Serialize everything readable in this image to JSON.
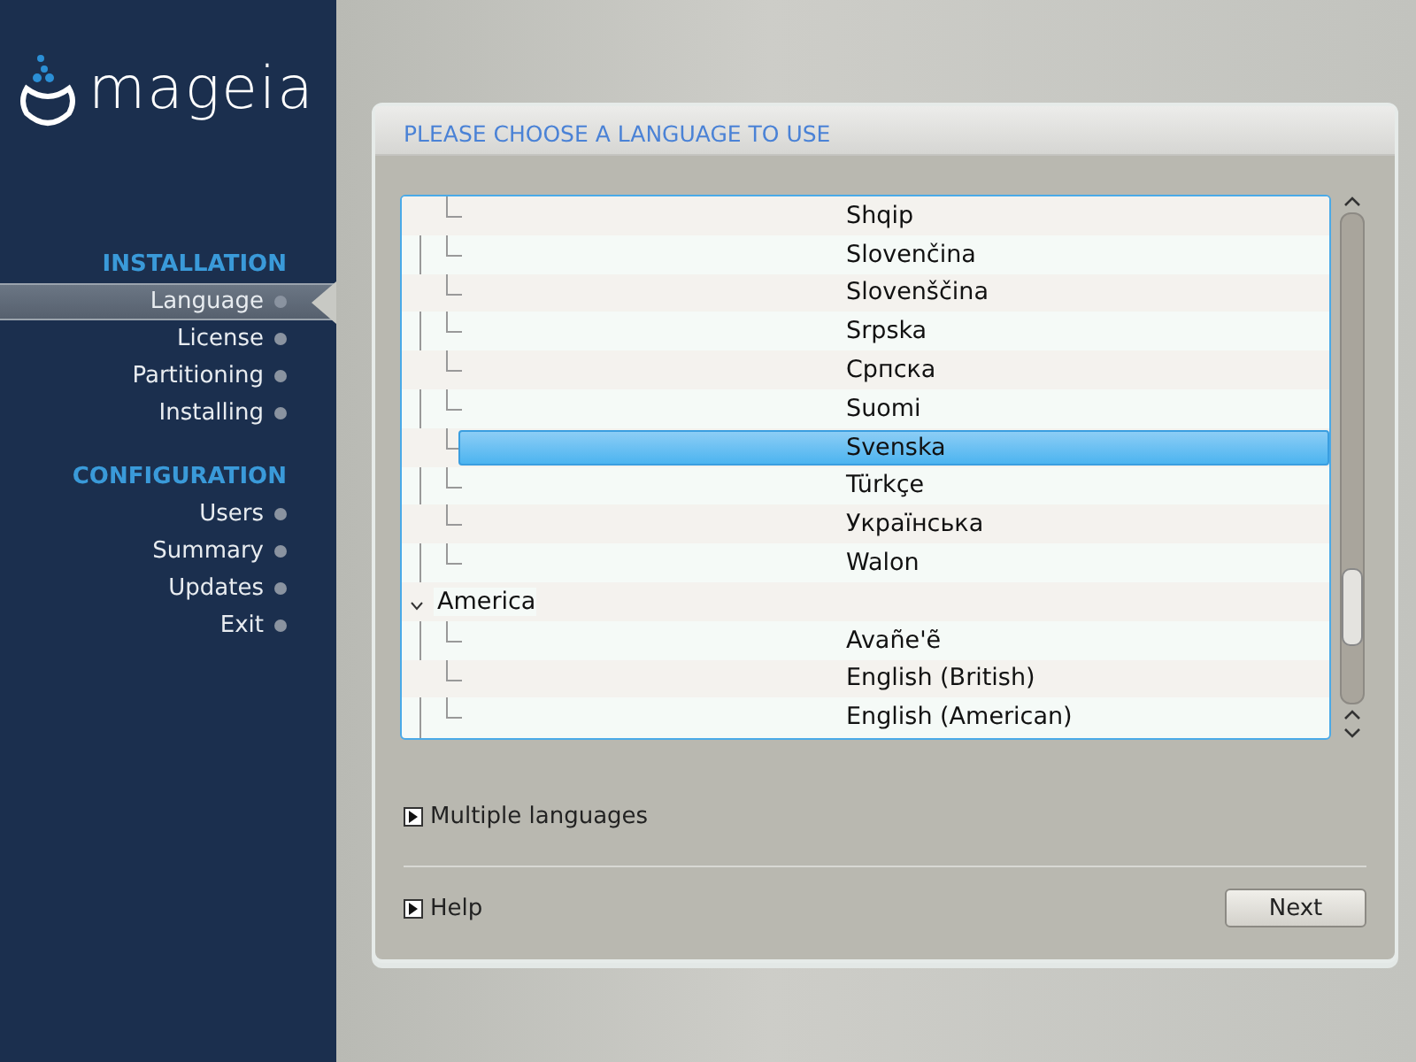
{
  "sidebar": {
    "logo": "mageia",
    "sections": [
      {
        "title": "INSTALLATION",
        "items": [
          {
            "label": "Language",
            "selected": true
          },
          {
            "label": "License",
            "selected": false
          },
          {
            "label": "Partitioning",
            "selected": false
          },
          {
            "label": "Installing",
            "selected": false
          }
        ]
      },
      {
        "title": "CONFIGURATION",
        "items": [
          {
            "label": "Users",
            "selected": false
          },
          {
            "label": "Summary",
            "selected": false
          },
          {
            "label": "Updates",
            "selected": false
          },
          {
            "label": "Exit",
            "selected": false
          }
        ]
      }
    ]
  },
  "panel": {
    "title": "PLEASE CHOOSE A LANGUAGE TO USE",
    "tree": [
      {
        "children": [
          {
            "label": "Shqip",
            "selected": false
          },
          {
            "label": "Slovenčina",
            "selected": false
          },
          {
            "label": "Slovenščina",
            "selected": false
          },
          {
            "label": "Srpska",
            "selected": false
          },
          {
            "label": "Српска",
            "selected": false
          },
          {
            "label": "Suomi",
            "selected": false
          },
          {
            "label": "Svenska",
            "selected": true
          },
          {
            "label": "Türkçe",
            "selected": false
          },
          {
            "label": "Українська",
            "selected": false
          },
          {
            "label": "Walon",
            "selected": false
          }
        ]
      },
      {
        "label": "America",
        "expanded": true,
        "children": [
          {
            "label": "Avañe'ẽ",
            "selected": false
          },
          {
            "label": "English (British)",
            "selected": false
          },
          {
            "label": "English (American)",
            "selected": false
          }
        ]
      }
    ],
    "expanders": [
      {
        "label": "Multiple languages",
        "expanded": false
      },
      {
        "label": "Help",
        "expanded": false
      }
    ],
    "buttons": [
      "Next"
    ]
  }
}
